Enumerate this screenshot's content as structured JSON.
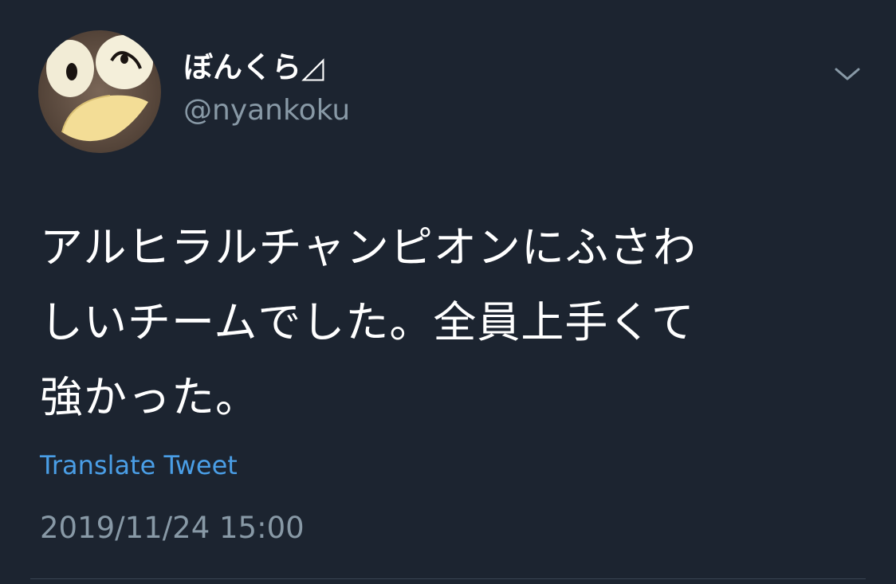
{
  "user": {
    "display_name": "ぼんくら◿",
    "handle": "@nyankoku",
    "avatar_icon": "cookie-face-avatar"
  },
  "tweet": {
    "text_lines": [
      "アルヒラルチャンピオンにふさわ",
      "しいチームでした。全員上手くて",
      "強かった。"
    ],
    "translate_label": "Translate Tweet",
    "timestamp": "2019/11/24 15:00"
  },
  "icons": {
    "caret": "chevron-down-icon"
  },
  "colors": {
    "background": "#1c2430",
    "text_primary": "#ffffff",
    "text_secondary": "#8899a6",
    "link": "#4a9ee6"
  }
}
